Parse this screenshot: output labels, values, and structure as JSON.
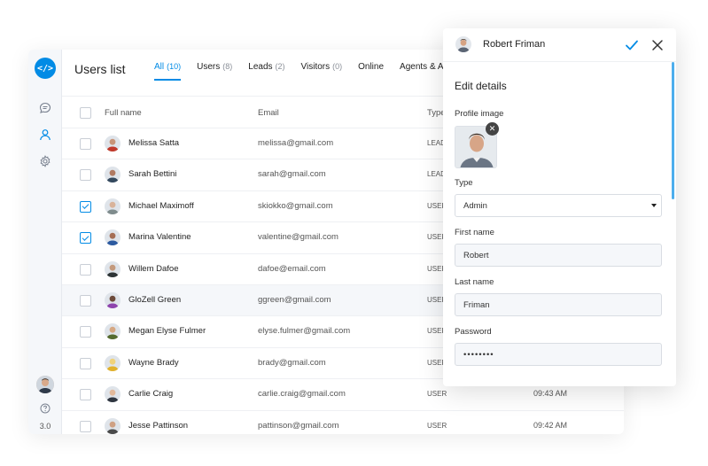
{
  "header": {
    "title": "Users list"
  },
  "tabs": [
    {
      "label": "All",
      "count": "(10)"
    },
    {
      "label": "Users",
      "count": "(8)"
    },
    {
      "label": "Leads",
      "count": "(2)"
    },
    {
      "label": "Visitors",
      "count": "(0)"
    },
    {
      "label": "Online",
      "count": ""
    },
    {
      "label": "Agents & Ad",
      "count": ""
    }
  ],
  "columns": {
    "full_name": "Full name",
    "email": "Email",
    "type": "Type"
  },
  "rows": [
    {
      "name": "Melissa Satta",
      "email": "melissa@gmail.com",
      "type": "LEAD",
      "time": "",
      "checked": false
    },
    {
      "name": "Sarah Bettini",
      "email": "sarah@gmail.com",
      "type": "LEAD",
      "time": "",
      "checked": false
    },
    {
      "name": "Michael Maximoff",
      "email": "skiokko@gmail.com",
      "type": "USER",
      "time": "",
      "checked": true
    },
    {
      "name": "Marina Valentine",
      "email": "valentine@gmail.com",
      "type": "USER",
      "time": "",
      "checked": true
    },
    {
      "name": "Willem Dafoe",
      "email": "dafoe@email.com",
      "type": "USER",
      "time": "",
      "checked": false
    },
    {
      "name": "GloZell Green",
      "email": "ggreen@gmail.com",
      "type": "USER",
      "time": "",
      "checked": false
    },
    {
      "name": "Megan Elyse Fulmer",
      "email": "elyse.fulmer@gmail.com",
      "type": "USER",
      "time": "",
      "checked": false
    },
    {
      "name": "Wayne Brady",
      "email": "brady@gmail.com",
      "type": "USER",
      "time": "",
      "checked": false
    },
    {
      "name": "Carlie Craig",
      "email": "carlie.craig@gmail.com",
      "type": "USER",
      "time": "09:43 AM",
      "checked": false
    },
    {
      "name": "Jesse Pattinson",
      "email": "pattinson@gmail.com",
      "type": "USER",
      "time": "09:42 AM",
      "checked": false
    }
  ],
  "sidebar": {
    "version": "3.0"
  },
  "panel": {
    "user_name": "Robert Friman",
    "section_title": "Edit details",
    "profile_image_label": "Profile image",
    "type_label": "Type",
    "type_value": "Admin",
    "first_name_label": "First name",
    "first_name_value": "Robert",
    "last_name_label": "Last name",
    "last_name_value": "Friman",
    "password_label": "Password",
    "password_value": "••••••••"
  },
  "colors": {
    "accent": "#028be5"
  },
  "icons": {
    "logo": "code-chat-icon",
    "chat": "chat-icon",
    "users": "user-icon",
    "settings": "gear-icon",
    "help": "help-icon",
    "confirm": "check-icon",
    "close": "close-icon"
  }
}
